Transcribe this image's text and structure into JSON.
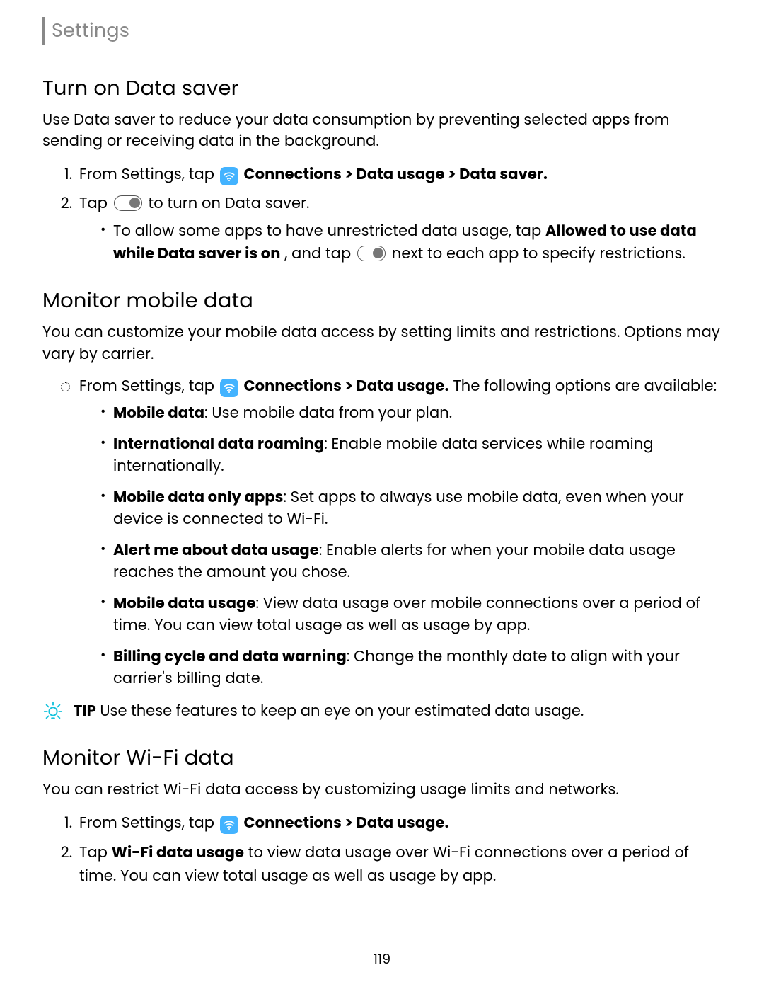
{
  "breadcrumb": "Settings",
  "section1_title": "Turn on Data saver",
  "section1_intro": "Use Data saver to reduce your data consumption by preventing selected apps from sending or receiving data in the background.",
  "s1_step1_pre": "From Settings, tap ",
  "s1_step1_bold": "Connections > Data usage > Data saver.",
  "s1_step2_pre": "Tap ",
  "s1_step2_post": " to turn on Data saver.",
  "s1_bullet_pre": "To allow some apps to have unrestricted data usage, tap ",
  "s1_bullet_b1": "Allowed to use data while Data saver is on",
  "s1_bullet_mid": ", and tap ",
  "s1_bullet_post": " next to each app to specify restrictions.",
  "section2_title": "Monitor mobile data",
  "section2_intro": "You can customize your mobile data access by setting limits and restrictions. Options may vary by carrier.",
  "s2_circ_pre": "From Settings, tap ",
  "s2_circ_bold": "Connections > Data usage.",
  "s2_circ_post": " The following options are available:",
  "s2_b1_l": "Mobile data",
  "s2_b1_r": ": Use mobile data from your plan.",
  "s2_b2_l": "International data roaming",
  "s2_b2_r": ": Enable mobile data services while roaming internationally.",
  "s2_b3_l": "Mobile data only apps",
  "s2_b3_r": ": Set apps to always use mobile data, even when your device is connected to Wi-Fi.",
  "s2_b4_l": "Alert me about data usage",
  "s2_b4_r": ": Enable alerts for when your mobile data usage reaches the amount you chose.",
  "s2_b5_l": "Mobile data usage",
  "s2_b5_r": ": View data usage over mobile connections over a period of time. You can view total usage as well as usage by app.",
  "s2_b6_l": "Billing cycle and data warning",
  "s2_b6_r": ": Change the monthly date to align with your carrier's billing date.",
  "tip_label": "TIP",
  "tip_text": "  Use these features to keep an eye on your estimated data usage.",
  "section3_title": "Monitor Wi-Fi data",
  "section3_intro": "You can restrict Wi-Fi data access by customizing usage limits and networks.",
  "s3_step1_pre": "From Settings, tap ",
  "s3_step1_bold": "Connections > Data usage.",
  "s3_step2_pre": "Tap ",
  "s3_step2_bold": "Wi-Fi data usage",
  "s3_step2_post": " to view data usage over Wi-Fi connections over a period of time. You can view total usage as well as usage by app.",
  "page_number": "119"
}
